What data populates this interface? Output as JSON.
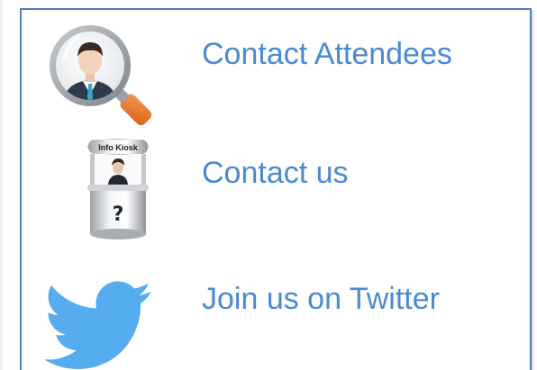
{
  "links": [
    {
      "label": "Contact Attendees",
      "icon": "attendee-search-icon"
    },
    {
      "label": "Contact us",
      "icon": "info-kiosk-icon",
      "icon_text": "Info Kiosk"
    },
    {
      "label": "Join us on Twitter",
      "icon": "twitter-bird-icon"
    }
  ],
  "colors": {
    "link_text": "#4a8ad0",
    "panel_border": "#4f7fbf",
    "twitter_blue": "#55acee",
    "magnifier_handle": "#f07828"
  }
}
